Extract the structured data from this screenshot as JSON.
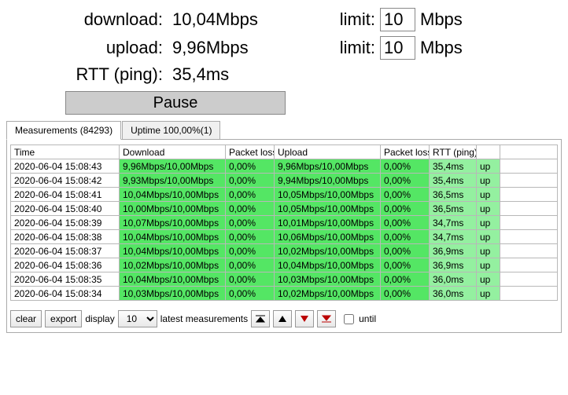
{
  "stats": {
    "download_label": "download:",
    "download_value": "10,04Mbps",
    "upload_label": "upload:",
    "upload_value": "9,96Mbps",
    "rtt_label": "RTT (ping):",
    "rtt_value": "35,4ms",
    "limit_label": "limit:",
    "download_limit": "10",
    "upload_limit": "10",
    "limit_unit": "Mbps"
  },
  "pause_label": "Pause",
  "tabs": {
    "measurements": "Measurements  (84293)",
    "uptime": "Uptime  100,00%(1)"
  },
  "headers": {
    "time": "Time",
    "download": "Download",
    "packet_loss": "Packet loss",
    "upload": "Upload",
    "rtt": "RTT (ping)"
  },
  "rows": [
    {
      "time": "2020-06-04 15:08:43",
      "dl": "9,96Mbps/10,00Mbps",
      "pl1": "0,00%",
      "ul": "9,96Mbps/10,00Mbps",
      "pl2": "0,00%",
      "rtt": "35,4ms",
      "up": "up"
    },
    {
      "time": "2020-06-04 15:08:42",
      "dl": "9,93Mbps/10,00Mbps",
      "pl1": "0,00%",
      "ul": "9,94Mbps/10,00Mbps",
      "pl2": "0,00%",
      "rtt": "35,4ms",
      "up": "up"
    },
    {
      "time": "2020-06-04 15:08:41",
      "dl": "10,04Mbps/10,00Mbps",
      "pl1": "0,00%",
      "ul": "10,05Mbps/10,00Mbps",
      "pl2": "0,00%",
      "rtt": "36,5ms",
      "up": "up"
    },
    {
      "time": "2020-06-04 15:08:40",
      "dl": "10,00Mbps/10,00Mbps",
      "pl1": "0,00%",
      "ul": "10,05Mbps/10,00Mbps",
      "pl2": "0,00%",
      "rtt": "36,5ms",
      "up": "up"
    },
    {
      "time": "2020-06-04 15:08:39",
      "dl": "10,07Mbps/10,00Mbps",
      "pl1": "0,00%",
      "ul": "10,01Mbps/10,00Mbps",
      "pl2": "0,00%",
      "rtt": "34,7ms",
      "up": "up"
    },
    {
      "time": "2020-06-04 15:08:38",
      "dl": "10,04Mbps/10,00Mbps",
      "pl1": "0,00%",
      "ul": "10,06Mbps/10,00Mbps",
      "pl2": "0,00%",
      "rtt": "34,7ms",
      "up": "up"
    },
    {
      "time": "2020-06-04 15:08:37",
      "dl": "10,04Mbps/10,00Mbps",
      "pl1": "0,00%",
      "ul": "10,02Mbps/10,00Mbps",
      "pl2": "0,00%",
      "rtt": "36,9ms",
      "up": "up"
    },
    {
      "time": "2020-06-04 15:08:36",
      "dl": "10,02Mbps/10,00Mbps",
      "pl1": "0,00%",
      "ul": "10,04Mbps/10,00Mbps",
      "pl2": "0,00%",
      "rtt": "36,9ms",
      "up": "up"
    },
    {
      "time": "2020-06-04 15:08:35",
      "dl": "10,04Mbps/10,00Mbps",
      "pl1": "0,00%",
      "ul": "10,03Mbps/10,00Mbps",
      "pl2": "0,00%",
      "rtt": "36,0ms",
      "up": "up"
    },
    {
      "time": "2020-06-04 15:08:34",
      "dl": "10,03Mbps/10,00Mbps",
      "pl1": "0,00%",
      "ul": "10,02Mbps/10,00Mbps",
      "pl2": "0,00%",
      "rtt": "36,0ms",
      "up": "up"
    }
  ],
  "footer": {
    "clear": "clear",
    "export": "export",
    "display": "display",
    "count": "10",
    "latest": "latest measurements",
    "until": "until"
  }
}
